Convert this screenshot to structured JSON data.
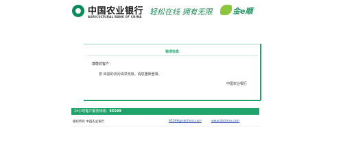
{
  "header": {
    "bank_name_cn": "中国农业银行",
    "bank_name_en": "AGRICULTURAL BANK OF CHINA",
    "slogan": "轻松在线  拥有无限",
    "brand_name": "金e顺"
  },
  "panel": {
    "title": "错误信息",
    "greeting": "尊敬的客户：",
    "message": "您 目前的访问请求无效，请您重新登录。",
    "signature": "中国农业银行"
  },
  "hotline": {
    "label": "24小时客户服务热线：",
    "number": "95599"
  },
  "footer": {
    "copyright": "版权所有  中国农业银行",
    "link_1": "95599@abchina.com",
    "link_2": "www.abchina.com"
  },
  "colors": {
    "brand_green": "#20a36b",
    "logo_green": "#0b8a5b",
    "accent_lime": "#8cc63f"
  }
}
